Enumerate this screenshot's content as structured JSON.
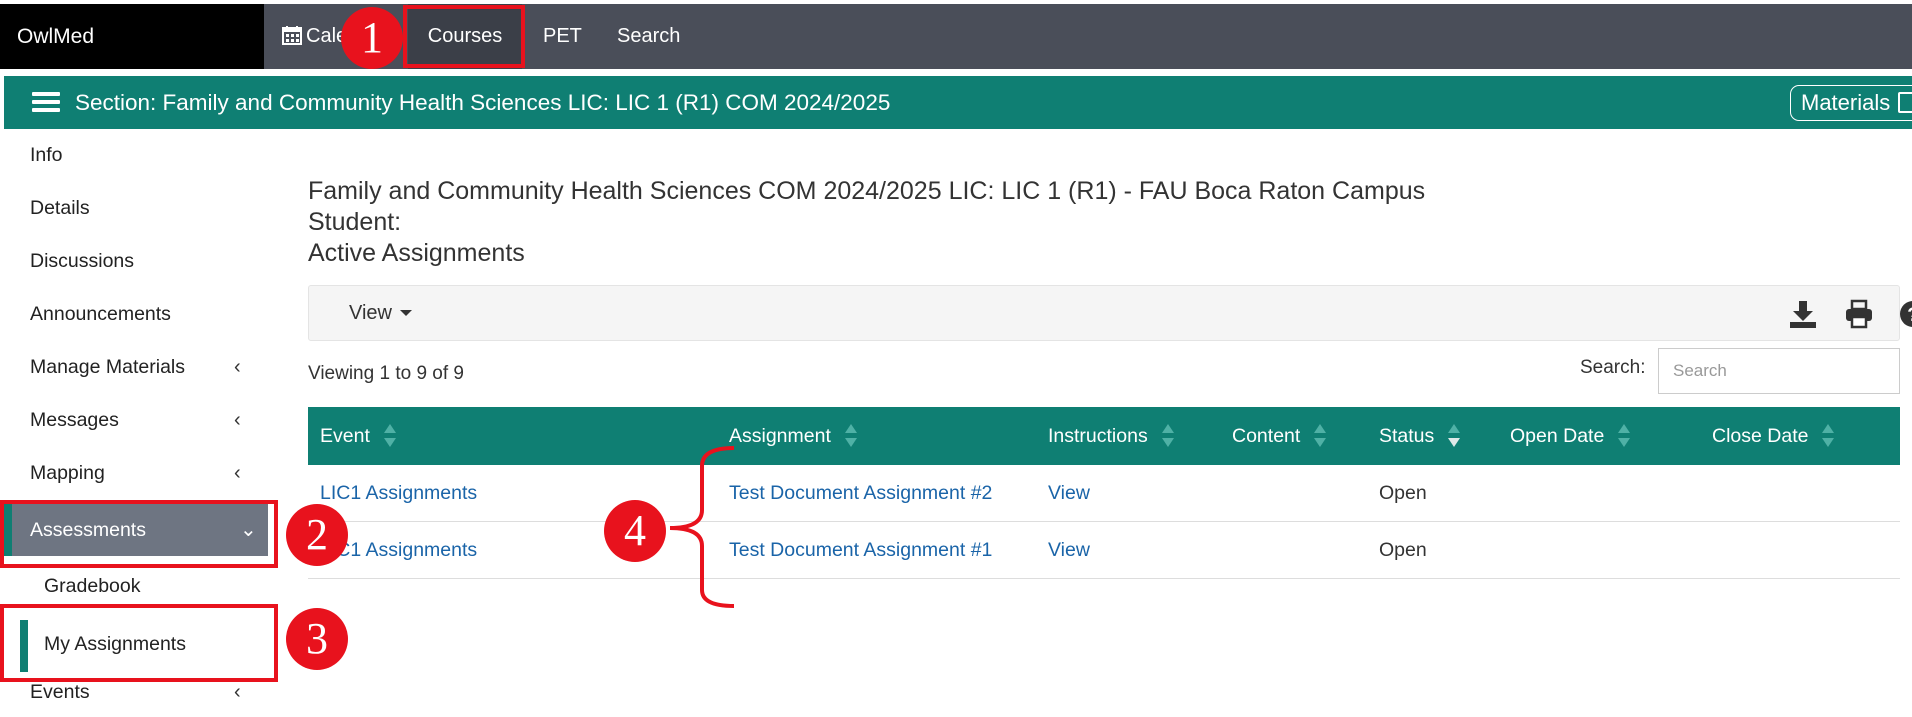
{
  "app": {
    "name": "OwlMed"
  },
  "topnav": {
    "items": [
      {
        "label": "Calendar",
        "icon": "calendar-icon"
      },
      {
        "label": "Courses"
      },
      {
        "label": "PET"
      },
      {
        "label": "Search"
      }
    ]
  },
  "section": {
    "title": "Section: Family and Community Health Sciences LIC: LIC 1 (R1) COM 2024/2025",
    "materials_label": "Materials"
  },
  "sidebar": {
    "items": [
      {
        "label": "Info"
      },
      {
        "label": "Details"
      },
      {
        "label": "Discussions"
      },
      {
        "label": "Announcements"
      },
      {
        "label": "Manage Materials",
        "chevron": "‹"
      },
      {
        "label": "Messages",
        "chevron": "‹"
      },
      {
        "label": "Mapping",
        "chevron": "‹"
      },
      {
        "label": "Assessments",
        "chevron": "⌄"
      },
      {
        "label": "Gradebook"
      },
      {
        "label": "My Assignments"
      },
      {
        "label": "Events",
        "chevron": "‹"
      }
    ]
  },
  "main": {
    "course_line": "Family and Community Health Sciences COM 2024/2025 LIC: LIC 1 (R1) - FAU Boca Raton Campus",
    "student_line": "Student:",
    "heading": "Active Assignments",
    "view_label": "View",
    "viewing_text": "Viewing 1 to 9 of 9",
    "search_label": "Search:",
    "search_placeholder": "Search"
  },
  "table": {
    "columns": [
      "Event",
      "Assignment",
      "Instructions",
      "Content",
      "Status",
      "Open Date",
      "Close Date"
    ],
    "rows": [
      {
        "event": "LIC1 Assignments",
        "assignment": "Test Document Assignment #2",
        "instructions": "View",
        "content": "",
        "status": "Open",
        "open_date": "",
        "close_date": ""
      },
      {
        "event": "LIC1 Assignments",
        "assignment": "Test Document Assignment #1",
        "instructions": "View",
        "content": "",
        "status": "Open",
        "open_date": "",
        "close_date": ""
      }
    ]
  },
  "annotations": {
    "badges": [
      "1",
      "2",
      "3",
      "4"
    ],
    "color": "#e8121d"
  },
  "colors": {
    "teal": "#0f7f73",
    "nav_bg": "#4a4e59",
    "link": "#1a64a8"
  }
}
